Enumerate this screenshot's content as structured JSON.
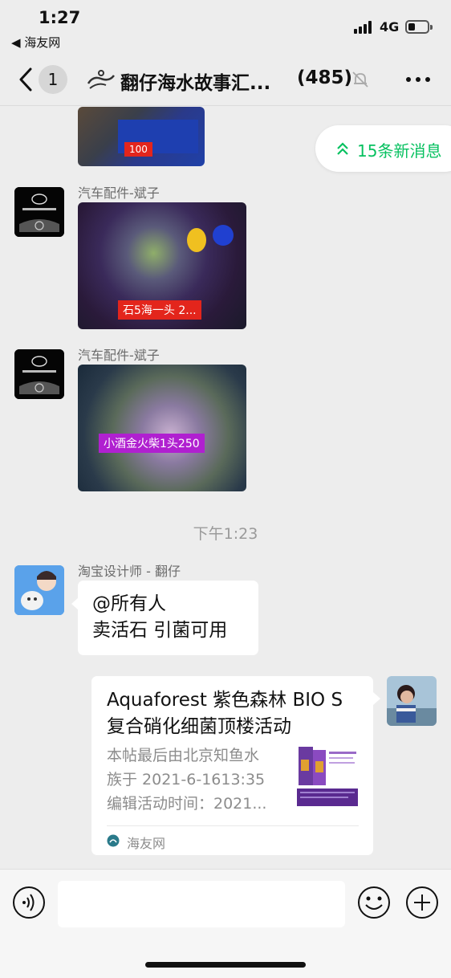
{
  "status_bar": {
    "time": "1:27",
    "back_app": "◀ 海友网",
    "network": "4G"
  },
  "nav": {
    "unread_badge": "1",
    "title": "翻仔海水故事汇...",
    "member_count": "(485)"
  },
  "new_messages": {
    "label": "15条新消息",
    "accent": "#07c160"
  },
  "messages": [
    {
      "sender": "汽车配件-斌子",
      "type": "image",
      "price_tag": "石5海一头 2...",
      "tag_color": "#e3251c"
    },
    {
      "sender": "汽车配件-斌子",
      "type": "image",
      "price_tag": "小酒金火柴1头250",
      "tag_color": "#b020d0"
    }
  ],
  "top_image": {
    "price_tag": "100",
    "tag_color": "#e3251c"
  },
  "time_divider": "下午1:23",
  "text_message": {
    "sender": "淘宝设计师 - 翻仔",
    "lines": [
      "@所有人",
      "卖活石 引菌可用"
    ]
  },
  "link_card": {
    "title_line1": "Aquaforest 紫色森林 BIO S",
    "title_line2": "复合硝化细菌顶楼活动",
    "desc_line1": "本帖最后由北京知鱼水",
    "desc_line2": "族于 2021-6-1613:35",
    "desc_line3": "编辑活动时间：2021...",
    "source": "海友网"
  },
  "input_bar": {
    "placeholder": ""
  }
}
